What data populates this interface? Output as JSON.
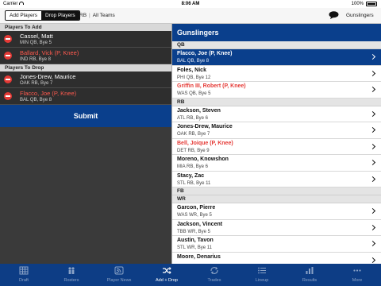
{
  "status_bar": {
    "carrier": "Carrier",
    "time": "8:06 AM",
    "battery": "100%"
  },
  "toolbar": {
    "add_players": "Add Players",
    "drop_players": "Drop Players",
    "position_filter": "RB",
    "team_filter": "All Teams",
    "chat_icon": "speech-bubble-icon",
    "team_name": "Gunslingers"
  },
  "left": {
    "add_header": "Players To Add",
    "add_players": [
      {
        "name": "Cassel, Matt",
        "info": "MIN QB, Bye 5",
        "injured": false
      },
      {
        "name": "Ballard, Vick (P, Knee)",
        "info": "IND RB, Bye 8",
        "injured": true
      }
    ],
    "drop_header": "Players To Drop",
    "drop_players": [
      {
        "name": "Jones-Drew, Maurice",
        "info": "OAK RB, Bye 7",
        "injured": false
      },
      {
        "name": "Flacco, Joe (P, Knee)",
        "info": "BAL QB, Bye 8",
        "injured": true
      }
    ],
    "submit": "Submit"
  },
  "right": {
    "team_header": "Gunslingers",
    "groups": [
      {
        "pos": "QB",
        "players": [
          {
            "name": "Flacco, Joe (P, Knee)",
            "info": "BAL QB, Bye 8",
            "injured": true,
            "selected": true
          },
          {
            "name": "Foles, Nick",
            "info": "PHI QB, Bye 12",
            "injured": false,
            "selected": false
          },
          {
            "name": "Griffin III, Robert (P, Knee)",
            "info": "WAS QB, Bye 5",
            "injured": true,
            "selected": false
          }
        ]
      },
      {
        "pos": "RB",
        "players": [
          {
            "name": "Jackson, Steven",
            "info": "ATL RB, Bye 6",
            "injured": false,
            "selected": false
          },
          {
            "name": "Jones-Drew, Maurice",
            "info": "OAK RB, Bye 7",
            "injured": false,
            "selected": false
          },
          {
            "name": "Bell, Joique (P, Knee)",
            "info": "DET RB, Bye 9",
            "injured": true,
            "selected": false
          },
          {
            "name": "Moreno, Knowshon",
            "info": "MIA RB, Bye 6",
            "injured": false,
            "selected": false
          },
          {
            "name": "Stacy, Zac",
            "info": "STL RB, Bye 11",
            "injured": false,
            "selected": false
          }
        ]
      },
      {
        "pos": "FB",
        "players": []
      },
      {
        "pos": "WR",
        "players": [
          {
            "name": "Garcon, Pierre",
            "info": "WAS WR, Bye 5",
            "injured": false,
            "selected": false
          },
          {
            "name": "Jackson, Vincent",
            "info": "TBB WR, Bye 5",
            "injured": false,
            "selected": false
          },
          {
            "name": "Austin, Tavon",
            "info": "STL WR, Bye 11",
            "injured": false,
            "selected": false
          },
          {
            "name": "Moore, Denarius",
            "info": "",
            "injured": false,
            "selected": false
          }
        ]
      }
    ]
  },
  "tabs": [
    {
      "label": "Draft",
      "icon": "grid-icon",
      "active": false
    },
    {
      "label": "Rosters",
      "icon": "players-icon",
      "active": false
    },
    {
      "label": "Player News",
      "icon": "rss-icon",
      "active": false
    },
    {
      "label": "Add + Drop",
      "icon": "shuffle-icon",
      "active": true
    },
    {
      "label": "Trades",
      "icon": "swap-icon",
      "active": false
    },
    {
      "label": "Lineup",
      "icon": "list-icon",
      "active": false
    },
    {
      "label": "Results",
      "icon": "chart-icon",
      "active": false
    },
    {
      "label": "More",
      "icon": "more-icon",
      "active": false
    }
  ],
  "colors": {
    "accent": "#0a3f8c",
    "injured": "#e53935",
    "remove": "#e53935"
  }
}
